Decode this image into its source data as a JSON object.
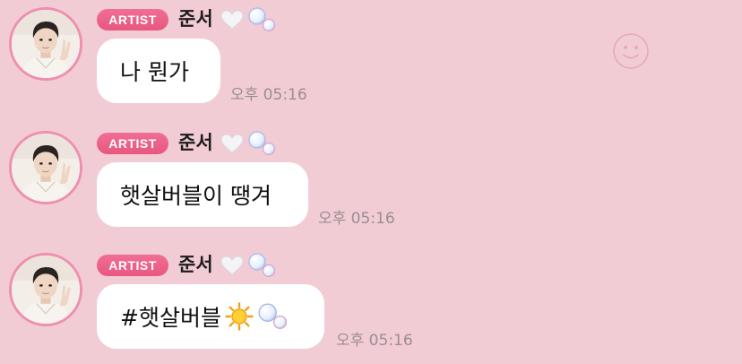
{
  "chat": {
    "messages": [
      {
        "badge": "ARTIST",
        "name": "준서",
        "text": "나 뭔가",
        "time": "오후 05:16"
      },
      {
        "badge": "ARTIST",
        "name": "준서",
        "text": "햇살버블이 땡겨",
        "time": "오후 05:16"
      },
      {
        "badge": "ARTIST",
        "name": "준서",
        "text": "#햇살버블",
        "time": "오후 05:16",
        "trailing_icons": [
          "sun-icon",
          "bubbles-icon"
        ]
      }
    ]
  },
  "icons": {
    "name_heart": "white-heart-icon",
    "name_bubbles": "bubbles-icon",
    "emoji_button": "smiley-face-icon"
  },
  "colors": {
    "background": "#f2ccd5",
    "badge": "#e8577f",
    "avatar_ring": "#ee8fb0",
    "bubble": "#ffffff",
    "time": "#9a8d91"
  }
}
